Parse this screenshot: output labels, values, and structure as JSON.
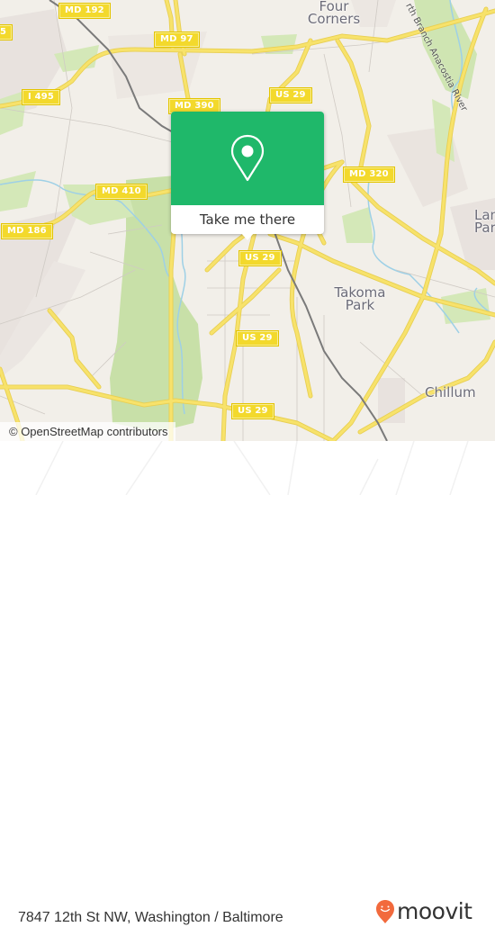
{
  "map": {
    "type": "street-map",
    "attribution": "© OpenStreetMap contributors",
    "route_shields": [
      {
        "label": "MD 192",
        "id": "md192"
      },
      {
        "label": "MD 97",
        "id": "md97"
      },
      {
        "label": "I 495",
        "id": "i495"
      },
      {
        "label": "MD 390",
        "id": "md390"
      },
      {
        "label": "US 29",
        "id": "us29-north"
      },
      {
        "label": "MD 320",
        "id": "md320"
      },
      {
        "label": "MD 410",
        "id": "md410"
      },
      {
        "label": "MD 186",
        "id": "md186"
      },
      {
        "label": "US 29",
        "id": "us29-center"
      },
      {
        "label": "US 29",
        "id": "us29-mid"
      },
      {
        "label": "US 29",
        "id": "us29-south"
      },
      {
        "label": "5",
        "id": "edge-left"
      }
    ],
    "place_labels": [
      {
        "label": "Four Corners"
      },
      {
        "label": "Takoma Park"
      },
      {
        "label": "Chillum"
      },
      {
        "label": "Langley Park"
      }
    ],
    "water_labels": [
      {
        "label": "Northwest Branch Anacostia River",
        "visible_text": "rth Branch Anacostia River"
      }
    ],
    "colors": {
      "land": "#f2efe9",
      "park": "#c8e0a8",
      "residential": "#e6e0dc",
      "major_road": "#f7e26b",
      "water": "#9ed0e6",
      "rail": "#777777",
      "shield": "#f3d92c"
    }
  },
  "popup": {
    "icon": "map-pin-icon",
    "cta_label": "Take me there",
    "color": "#1fb86a"
  },
  "footer": {
    "address": "7847 12th St NW, Washington / Baltimore",
    "brand": "moovit",
    "brand_color": "#f26a3d"
  }
}
